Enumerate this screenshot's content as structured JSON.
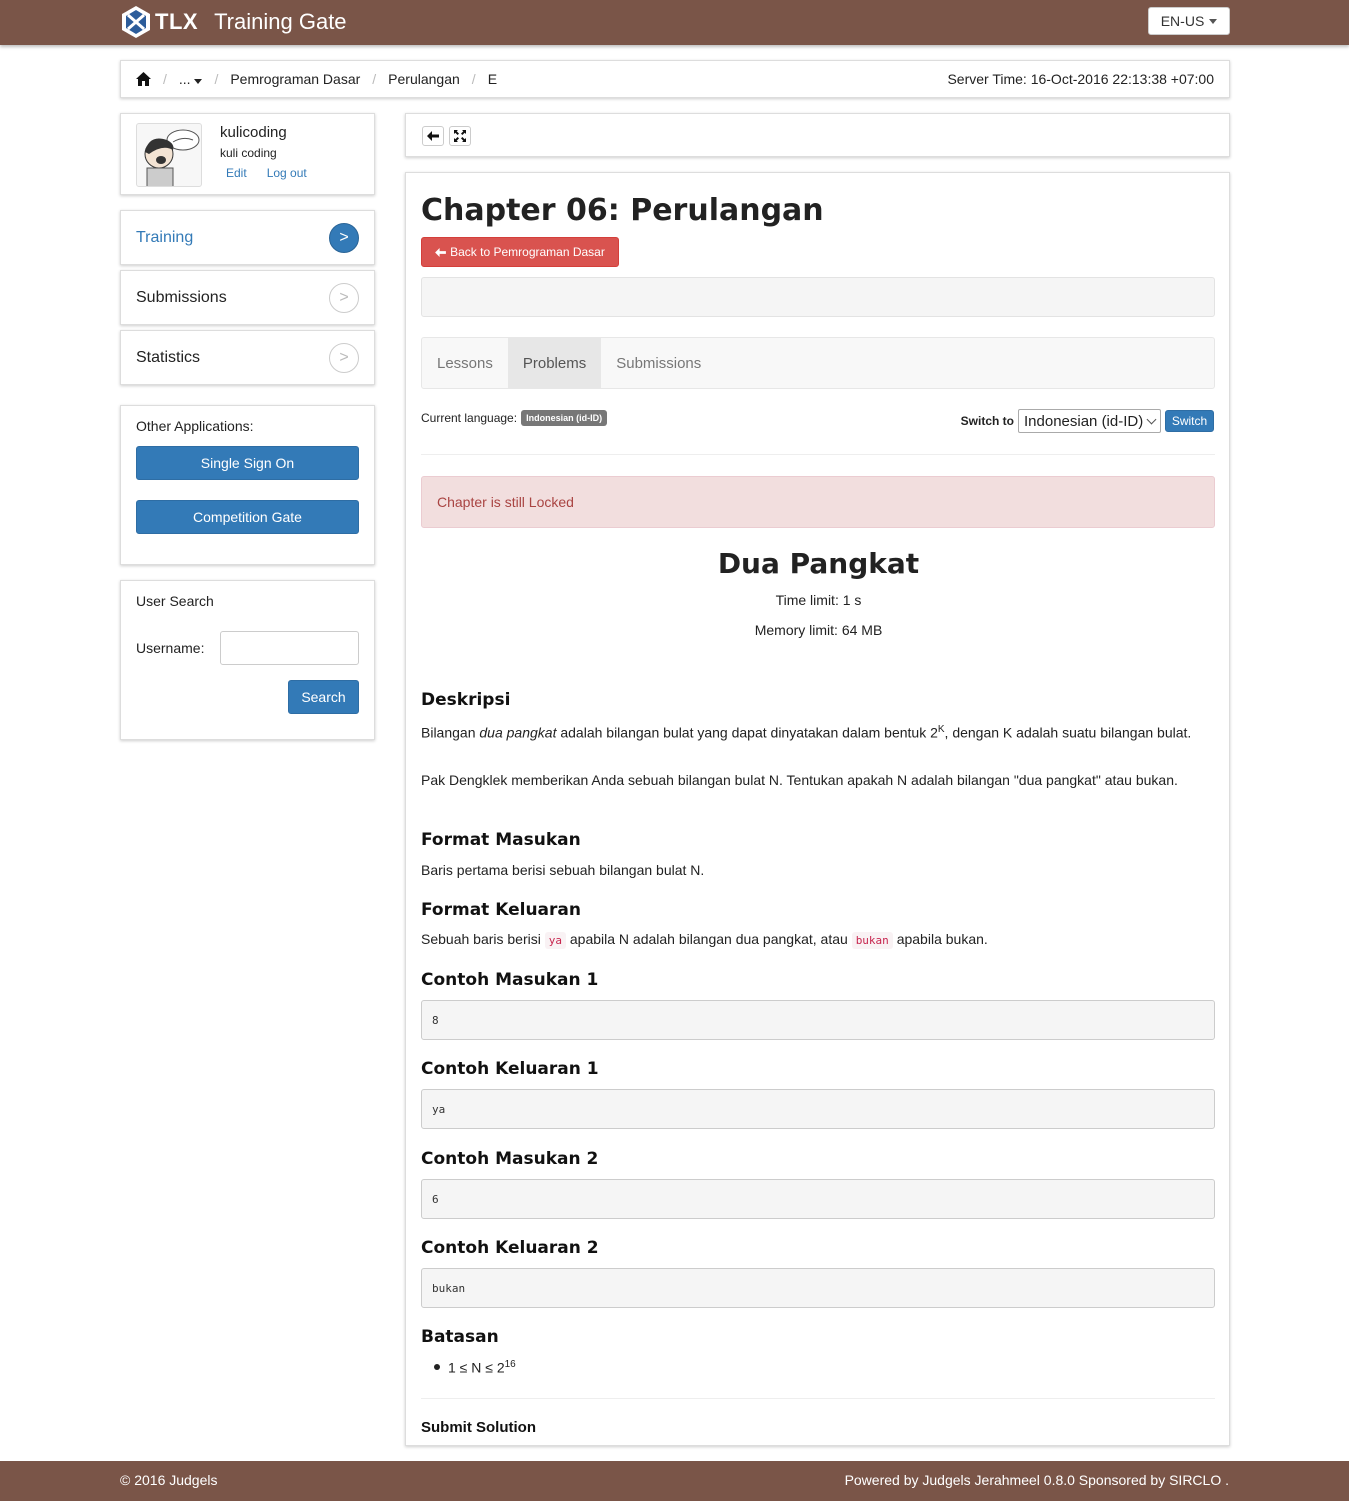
{
  "app": {
    "brand_short": "TLX",
    "brand_name": "Training Gate",
    "language_button": "EN-US",
    "colors": {
      "header": "#7a5548",
      "primary": "#337ab7",
      "danger": "#d9534f"
    }
  },
  "breadcrumb": {
    "home_icon": "home-icon",
    "items": [
      "...",
      "Pemrograman Dasar",
      "Perulangan",
      "E"
    ],
    "server_time": "Server Time: 16-Oct-2016 22:13:38 +07:00"
  },
  "profile": {
    "username": "kulicoding",
    "fullname": "kuli coding",
    "edit_label": "Edit",
    "logout_label": "Log out"
  },
  "sidebar": {
    "items": [
      {
        "label": "Training",
        "arrow": ">"
      },
      {
        "label": "Submissions",
        "arrow": ">"
      },
      {
        "label": "Statistics",
        "arrow": ">"
      }
    ],
    "other_apps_label": "Other Applications:",
    "sso_label": "Single Sign On",
    "competition_label": "Competition Gate",
    "user_search_title": "User Search",
    "username_label": "Username:",
    "search_label": "Search"
  },
  "toolbar": {
    "back_icon": "arrow-left-icon",
    "fullscreen_icon": "fullscreen-icon"
  },
  "chapter": {
    "title": "Chapter 06: Perulangan",
    "back_label": "Back to Pemrograman Dasar",
    "tabs": [
      "Lessons",
      "Problems",
      "Submissions"
    ],
    "current_language_label": "Current language:",
    "current_language": "Indonesian (id-ID)",
    "switch_to_label": "Switch to",
    "switch_select_value": "Indonesian (id-ID)",
    "switch_button": "Switch",
    "alert": "Chapter is still Locked"
  },
  "problem": {
    "title": "Dua Pangkat",
    "time_limit": "Time limit: 1 s",
    "memory_limit": "Memory limit: 64 MB",
    "sections": {
      "deskripsi": "Deskripsi",
      "format_masukan": "Format Masukan",
      "format_keluaran": "Format Keluaran",
      "contoh_masukan_1": "Contoh Masukan 1",
      "contoh_keluaran_1": "Contoh Keluaran 1",
      "contoh_masukan_2": "Contoh Masukan 2",
      "contoh_keluaran_2": "Contoh Keluaran 2",
      "batasan": "Batasan",
      "submit": "Submit Solution"
    },
    "desc1_a": "Bilangan ",
    "desc1_em": "dua pangkat",
    "desc1_b": " adalah bilangan bulat yang dapat dinyatakan dalam bentuk 2",
    "desc1_sup": "K",
    "desc1_c": ", dengan K adalah suatu bilangan bulat.",
    "desc2": "Pak Dengklek memberikan Anda sebuah bilangan bulat N. Tentukan apakah N adalah bilangan \"dua pangkat\" atau bukan.",
    "input_format": "Baris pertama berisi sebuah bilangan bulat N.",
    "output_a": "Sebuah baris berisi ",
    "output_code1": "ya",
    "output_b": " apabila N adalah bilangan dua pangkat, atau ",
    "output_code2": "bukan",
    "output_c": " apabila bukan.",
    "sample_in_1": "8",
    "sample_out_1": "ya",
    "sample_in_2": "6",
    "sample_out_2": "bukan",
    "constraint_base": "1 ≤ N ≤ 2",
    "constraint_exp": "16"
  },
  "footer": {
    "left": "© 2016 Judgels",
    "right": "Powered by Judgels Jerahmeel 0.8.0 Sponsored by SIRCLO ."
  }
}
